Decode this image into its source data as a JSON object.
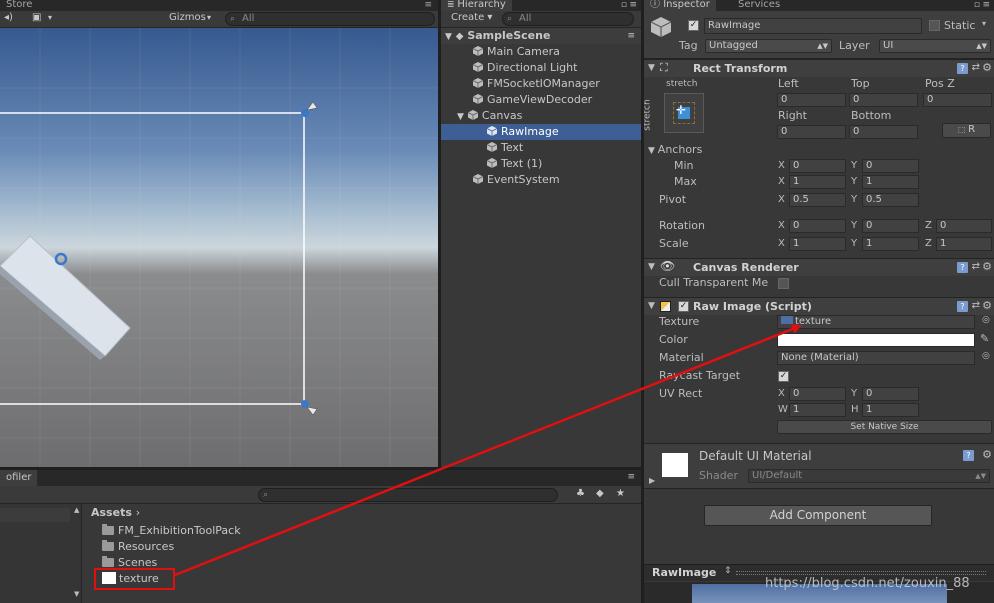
{
  "scene_panel": {
    "tab": "Store",
    "toolbar": {
      "gizmos": "Gizmos",
      "search_placeholder": "All"
    }
  },
  "hierarchy": {
    "tab": "Hierarchy",
    "create": "Create",
    "search_placeholder": "All",
    "scene": "SampleScene",
    "items": [
      "Main Camera",
      "Directional Light",
      "FMSocketIOManager",
      "GameViewDecoder",
      "Canvas",
      "RawImage",
      "Text",
      "Text (1)",
      "EventSystem"
    ]
  },
  "project_panel": {
    "tab": "ofiler",
    "assets_label": "Assets",
    "items": [
      "FM_ExhibitionToolPack",
      "Resources",
      "Scenes",
      "texture"
    ]
  },
  "inspector": {
    "tabs": [
      "Inspector",
      "Services"
    ],
    "object_name": "RawImage",
    "static_label": "Static",
    "tag_label": "Tag",
    "tag_value": "Untagged",
    "layer_label": "Layer",
    "layer_value": "UI",
    "rect_transform": {
      "title": "Rect Transform",
      "stretch_top": "stretch",
      "stretch_side": "stretch",
      "left_label": "Left",
      "left": "0",
      "top_label": "Top",
      "top": "0",
      "posz_label": "Pos Z",
      "posz": "0",
      "right_label": "Right",
      "right": "0",
      "bottom_label": "Bottom",
      "bottom": "0",
      "r_btn": "R",
      "anchors_label": "Anchors",
      "min_label": "Min",
      "min_x": "0",
      "min_y": "0",
      "max_label": "Max",
      "max_x": "1",
      "max_y": "1",
      "pivot_label": "Pivot",
      "pivot_x": "0.5",
      "pivot_y": "0.5",
      "rotation_label": "Rotation",
      "rot_x": "0",
      "rot_y": "0",
      "rot_z": "0",
      "scale_label": "Scale",
      "scale_x": "1",
      "scale_y": "1",
      "scale_z": "1"
    },
    "canvas_renderer": {
      "title": "Canvas Renderer",
      "cull_label": "Cull Transparent Me"
    },
    "raw_image": {
      "title": "Raw Image (Script)",
      "texture_label": "Texture",
      "texture_value": "texture",
      "color_label": "Color",
      "material_label": "Material",
      "material_value": "None (Material)",
      "raycast_label": "Raycast Target",
      "uvrect_label": "UV Rect",
      "uv_x": "0",
      "uv_y": "0",
      "uv_w": "1",
      "uv_h": "1",
      "set_native_size": "Set Native Size"
    },
    "material": {
      "name": "Default UI Material",
      "shader_label": "Shader",
      "shader_value": "UI/Default"
    },
    "add_component": "Add Component",
    "preview_title": "RawImage"
  },
  "watermark": "https://blog.csdn.net/zouxin_88",
  "axis_letters": {
    "x": "X",
    "y": "Y",
    "z": "Z",
    "w": "W",
    "h": "H"
  },
  "colors": {
    "selection": "#3e5f96",
    "annotation_red": "#e01010"
  }
}
